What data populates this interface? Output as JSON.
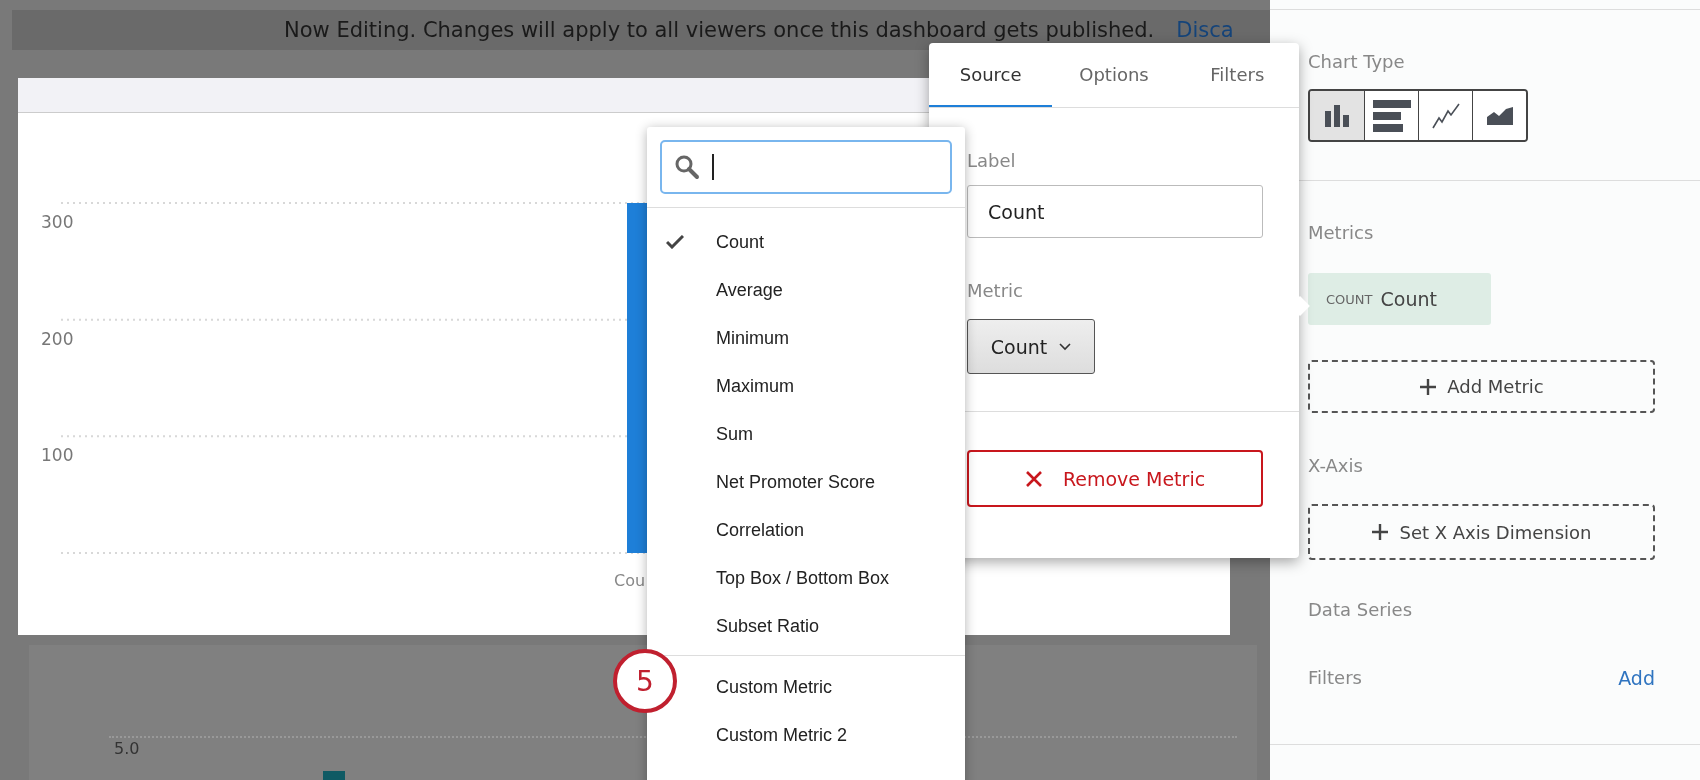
{
  "banner": {
    "message": "Now Editing. Changes will apply to all viewers once this dashboard gets published.",
    "link": "Disca"
  },
  "chart_widget": {
    "chart_data": {
      "type": "bar",
      "categories": [
        "Cou"
      ],
      "values": [
        300
      ],
      "ylim": [
        0,
        300
      ],
      "yticks": [
        100,
        200,
        300
      ]
    }
  },
  "lower_widget": {
    "y_tick_label": "5.0"
  },
  "metric_dropdown": {
    "items": [
      {
        "label": "Count",
        "selected": true
      },
      {
        "label": "Average",
        "selected": false
      },
      {
        "label": "Minimum",
        "selected": false
      },
      {
        "label": "Maximum",
        "selected": false
      },
      {
        "label": "Sum",
        "selected": false
      },
      {
        "label": "Net Promoter Score",
        "selected": false
      },
      {
        "label": "Correlation",
        "selected": false
      },
      {
        "label": "Top Box / Bottom Box",
        "selected": false
      },
      {
        "label": "Subset Ratio",
        "selected": false
      }
    ],
    "custom_items": [
      {
        "label": "Custom Metric",
        "selected": false
      },
      {
        "label": "Custom Metric 2",
        "selected": false
      }
    ]
  },
  "callout": {
    "number": "5"
  },
  "popover": {
    "tabs": [
      {
        "label": "Source",
        "selected": true
      },
      {
        "label": "Options",
        "selected": false
      },
      {
        "label": "Filters",
        "selected": false
      }
    ],
    "label_field": {
      "label": "Label",
      "value": "Count"
    },
    "metric_field": {
      "label": "Metric",
      "value": "Count"
    },
    "remove_button": "Remove Metric"
  },
  "sidebar": {
    "chart_type": {
      "label": "Chart Type",
      "options": [
        {
          "kind": "column",
          "selected": true
        },
        {
          "kind": "bar",
          "selected": false
        },
        {
          "kind": "line",
          "selected": false
        },
        {
          "kind": "area",
          "selected": false
        }
      ]
    },
    "metrics": {
      "label": "Metrics",
      "chips": [
        {
          "tag": "COUNT",
          "name": "Count"
        }
      ],
      "add_button": "Add Metric"
    },
    "x_axis": {
      "label": "X-Axis",
      "button": "Set X Axis Dimension"
    },
    "data_series": {
      "label": "Data Series"
    },
    "filters": {
      "label": "Filters",
      "link": "Add"
    }
  }
}
